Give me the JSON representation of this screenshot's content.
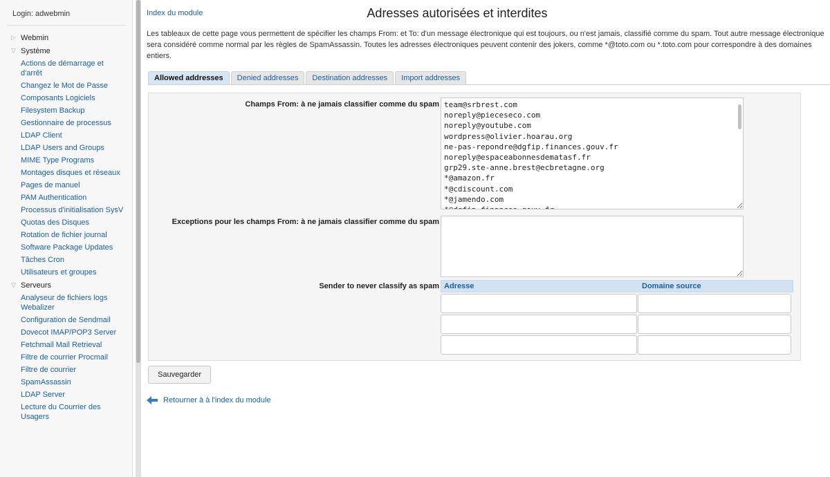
{
  "sidebar": {
    "login": "Login: adwebmin",
    "categories": [
      {
        "label": "Webmin",
        "items": []
      },
      {
        "label": "Système",
        "items": [
          "Actions de démarrage et d'arrêt",
          "Changez le Mot de Passe",
          "Composants Logiciels",
          "Filesystem Backup",
          "Gestionnaire de processus",
          "LDAP Client",
          "LDAP Users and Groups",
          "MIME Type Programs",
          "Montages disques et réseaux",
          "Pages de manuel",
          "PAM Authentication",
          "Processus d'initialisation SysV",
          "Quotas des Disques",
          "Rotation de fichier journal",
          "Software Package Updates",
          "Tâches Cron",
          "Utilisateurs et groupes"
        ]
      },
      {
        "label": "Serveurs",
        "items": [
          "Analyseur de fichiers logs Webalizer",
          "Configuration de Sendmail",
          "Dovecot IMAP/POP3 Server",
          "Fetchmail Mail Retrieval",
          "Filtre de courrier Procmail",
          "Filtre de courrier",
          "SpamAssassin",
          "LDAP Server",
          "Lecture du Courrier des Usagers"
        ]
      }
    ]
  },
  "main": {
    "index_link": "Index du module",
    "title": "Adresses autorisées et interdites",
    "description": "Les tableaux de cette page vous permettent de spécifier les champs From: et To: d'un message électronique qui est toujours, ou n'est jamais, classifié comme du spam. Tout autre message électronique sera considéré comme normal par les règles de SpamAssassin. Toutes les adresses électroniques peuvent contenir des jokers, comme *@toto.com ou *.toto.com pour correspondre à des domaines entiers.",
    "tabs": [
      {
        "label": "Allowed addresses",
        "active": true
      },
      {
        "label": "Denied addresses",
        "active": false
      },
      {
        "label": "Destination addresses",
        "active": false
      },
      {
        "label": "Import addresses",
        "active": false
      }
    ],
    "from_label": "Champs From: à ne jamais classifier comme du spam",
    "from_value": "team@srbrest.com\nnoreply@pieceseco.com\nnoreply@youtube.com\nwordpress@olivier.hoarau.org\nne-pas-repondre@dgfip.finances.gouv.fr\nnoreply@espaceabonnesdematasf.fr\ngrp29.ste-anne.brest@ecbretagne.org\n*@amazon.fr\n*@cdiscount.com\n*@jamendo.com\n*@dgfip.finances.gouv.fr",
    "exceptions_label": "Exceptions pour les champs From: à ne jamais classifier comme du spam",
    "exceptions_value": "",
    "sender_label": "Sender to never classify as spam",
    "sender_table": {
      "col_address": "Adresse",
      "col_domain": "Domaine source"
    },
    "save_label": "Sauvegarder",
    "return_label": "Retourner à à l'index du module"
  }
}
